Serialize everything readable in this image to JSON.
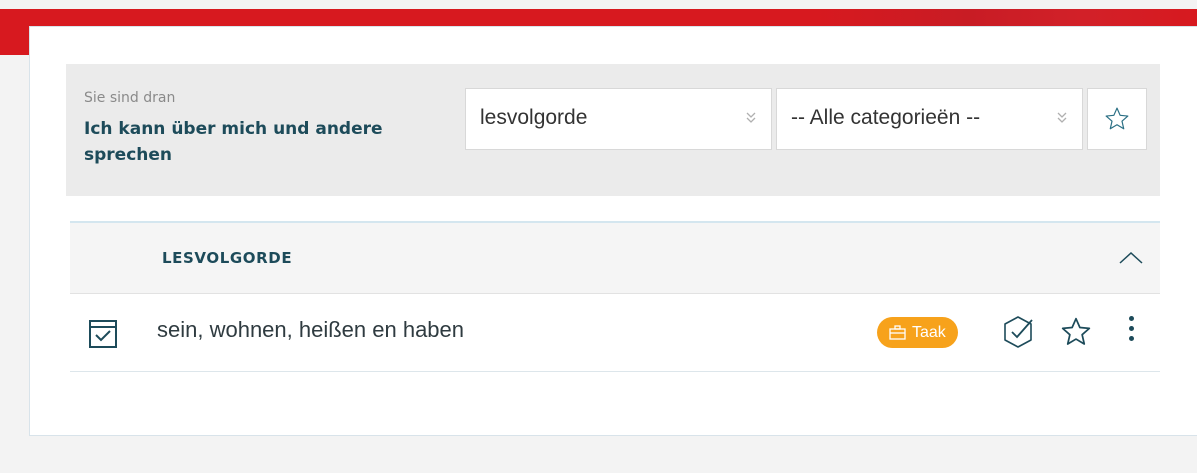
{
  "header": {
    "banner_color": "#d7191f"
  },
  "filter_panel": {
    "subtitle": "Sie sind dran",
    "title": "Ich kann über mich und andere sprechen",
    "order_select": {
      "value": "lesvolgorde"
    },
    "category_select": {
      "value": "-- Alle categorieën --"
    },
    "favorite_icon": "star-outline-icon"
  },
  "section": {
    "title": "LESVOLGORDE",
    "collapse_icon": "chevron-up-icon"
  },
  "items": [
    {
      "icon": "checkbox-document-icon",
      "label": "sein, wohnen, heißen en haben",
      "badge": {
        "label": "Taak",
        "icon": "briefcase-icon",
        "color": "#f7a21b"
      },
      "actions": [
        "mark-done-icon",
        "star-outline-icon",
        "more-vertical-icon"
      ]
    }
  ],
  "colors": {
    "accent_text": "#1d4b5a",
    "panel_bg": "#ebebeb"
  }
}
